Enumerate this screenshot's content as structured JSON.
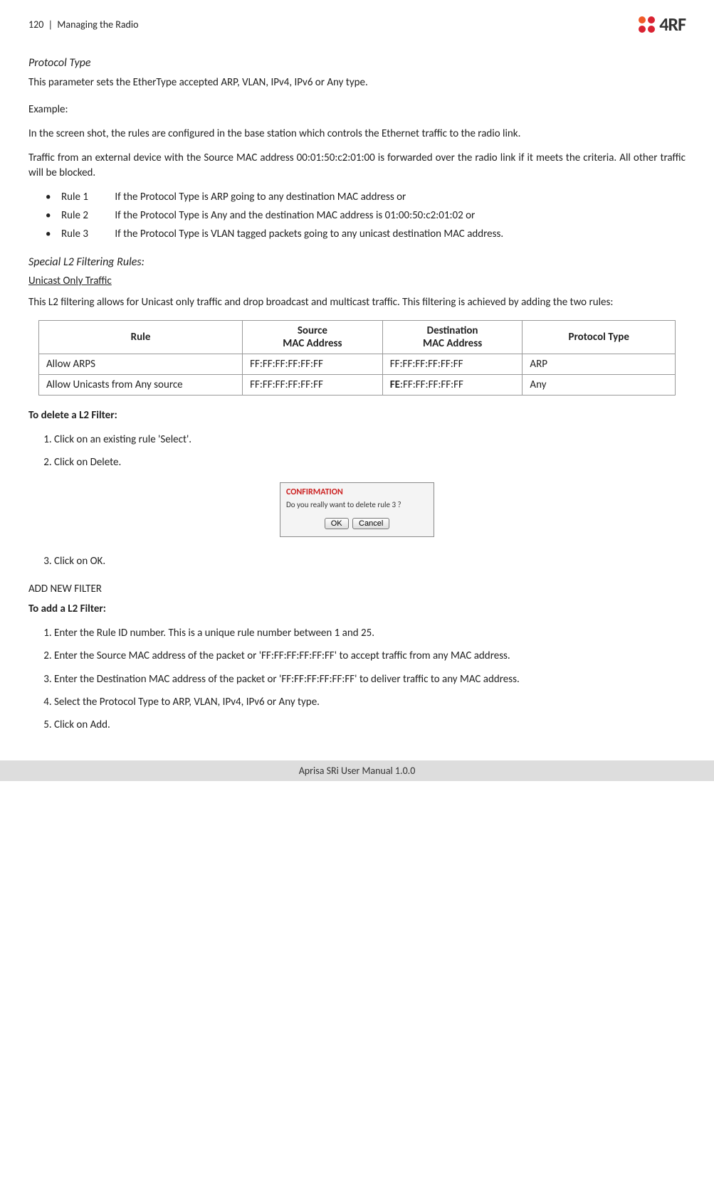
{
  "header": {
    "page_num": "120",
    "section": "Managing the Radio",
    "logo_text": "4RF"
  },
  "protocol_type": {
    "heading": "Protocol Type",
    "text": "This parameter sets the EtherType accepted ARP, VLAN, IPv4, IPv6 or Any type."
  },
  "example": {
    "heading": "Example:",
    "p1": "In the screen shot, the rules are configured in the base station which controls the Ethernet traffic to the radio link.",
    "p2": "Traffic from an external device with the Source MAC address 00:01:50:c2:01:00 is forwarded over the radio link if it meets the criteria. All other traffic will be blocked.",
    "rules": [
      {
        "label": "Rule 1",
        "text": "If the Protocol Type is ARP going to any destination MAC address or"
      },
      {
        "label": "Rule 2",
        "text": "If the Protocol Type is Any and the destination MAC address is 01:00:50:c2:01:02 or"
      },
      {
        "label": "Rule 3",
        "text": "If the Protocol Type is VLAN tagged packets going to any unicast destination MAC address."
      }
    ]
  },
  "special": {
    "heading": "Special L2 Filtering Rules:",
    "sub": "Unicast Only Traffic",
    "text": "This L2 filtering allows for Unicast only traffic and drop broadcast and multicast traffic. This filtering is achieved by adding the two rules:",
    "table": {
      "headers": {
        "rule": "Rule",
        "src1": "Source",
        "src2": "MAC Address",
        "dst1": "Destination",
        "dst2": "MAC Address",
        "proto": "Protocol Type"
      },
      "rows": [
        {
          "rule": "Allow ARPS",
          "src": "FF:FF:FF:FF:FF:FF",
          "dst_pre": "",
          "dst_bold": "",
          "dst_rest": "FF:FF:FF:FF:FF:FF",
          "proto": "ARP"
        },
        {
          "rule": "Allow Unicasts from Any source",
          "src": "FF:FF:FF:FF:FF:FF",
          "dst_pre": "",
          "dst_bold": "FE",
          "dst_rest": ":FF:FF:FF:FF:FF",
          "proto": "Any"
        }
      ]
    }
  },
  "delete": {
    "heading": "To delete a L2 Filter:",
    "steps": [
      "Click on an existing rule 'Select'.",
      "Click on Delete."
    ],
    "dialog": {
      "title": "CONFIRMATION",
      "body": "Do you really want to delete rule 3 ?",
      "ok": "OK",
      "cancel": "Cancel"
    },
    "after": "Click on OK."
  },
  "add": {
    "heading": "ADD NEW FILTER",
    "sub": "To add a L2 Filter:",
    "steps": [
      "Enter the Rule ID number. This is a unique rule number between 1 and 25.",
      "Enter the Source MAC address of the packet or 'FF:FF:FF:FF:FF:FF' to accept traffic from any MAC address.",
      "Enter the Destination MAC address of the packet or 'FF:FF:FF:FF:FF:FF' to deliver traffic to any MAC address.",
      "Select the Protocol Type to ARP, VLAN, IPv4, IPv6 or Any type.",
      "Click on Add."
    ]
  },
  "footer": "Aprisa SRi User Manual 1.0.0"
}
